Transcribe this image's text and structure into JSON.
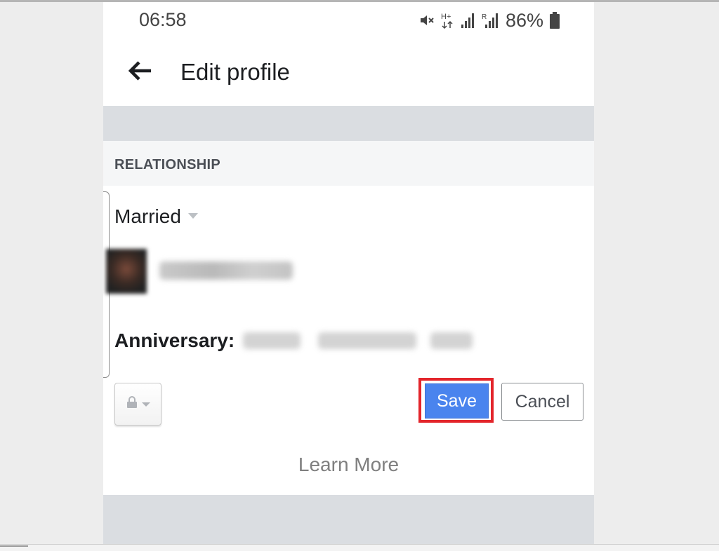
{
  "status_bar": {
    "time": "06:58",
    "battery_percent": "86%",
    "icons": [
      "mute-icon",
      "hplus-data-icon",
      "signal-icon",
      "roaming-signal-icon",
      "battery-icon"
    ]
  },
  "header": {
    "back_icon": "arrow-left-icon",
    "title": "Edit profile"
  },
  "relationship": {
    "section_title": "RELATIONSHIP",
    "status_value": "Married",
    "partner_name": "",
    "anniversary_label": "Anniversary:",
    "anniversary_year": "",
    "anniversary_month": "",
    "anniversary_day": ""
  },
  "actions": {
    "privacy_icon": "lock-icon",
    "save_label": "Save",
    "cancel_label": "Cancel",
    "learn_more_label": "Learn More"
  },
  "colors": {
    "save_button": "#4a84ee",
    "highlight_box": "#e3252b",
    "section_band": "#dadde1"
  }
}
